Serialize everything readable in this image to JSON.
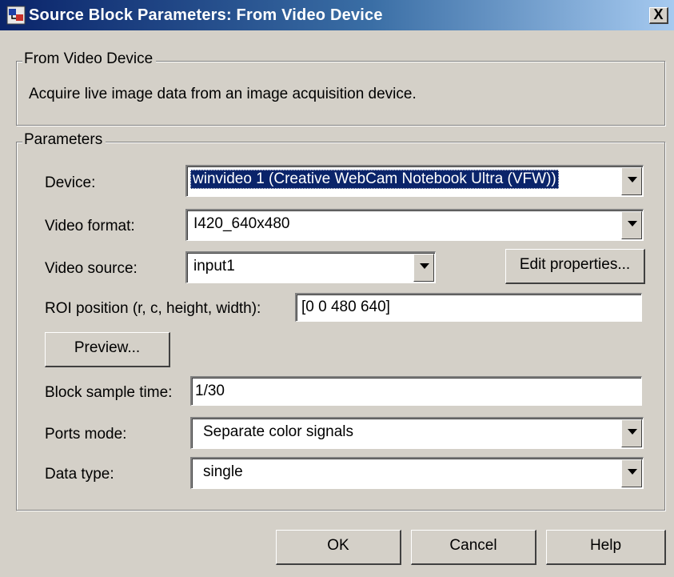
{
  "window": {
    "title": "Source Block Parameters: From Video Device",
    "close_label": "X"
  },
  "description_group": {
    "legend": "From Video Device",
    "text": "Acquire live image data from an image acquisition device."
  },
  "parameters_group": {
    "legend": "Parameters",
    "device": {
      "label": "Device:",
      "value": "winvideo 1 (Creative WebCam Notebook Ultra (VFW))"
    },
    "video_format": {
      "label": "Video format:",
      "value": "I420_640x480"
    },
    "video_source": {
      "label": "Video source:",
      "value": "input1"
    },
    "edit_properties_label": "Edit properties...",
    "roi_position": {
      "label": "ROI position (r, c, height, width):",
      "value": "[0 0 480 640]"
    },
    "preview_label": "Preview...",
    "block_sample_time": {
      "label": "Block sample time:",
      "value": "1/30"
    },
    "ports_mode": {
      "label": "Ports mode:",
      "value": "Separate color signals"
    },
    "data_type": {
      "label": "Data type:",
      "value": "single"
    }
  },
  "footer": {
    "ok_label": "OK",
    "cancel_label": "Cancel",
    "help_label": "Help"
  },
  "colors": {
    "titlebar_start": "#0a246a",
    "titlebar_end": "#a6caf0",
    "dialog_face": "#d4d0c8",
    "selection": "#0a246a"
  },
  "icons": {
    "title_icon": "simulink-block-icon",
    "dropdown_icon": "chevron-down-icon"
  }
}
